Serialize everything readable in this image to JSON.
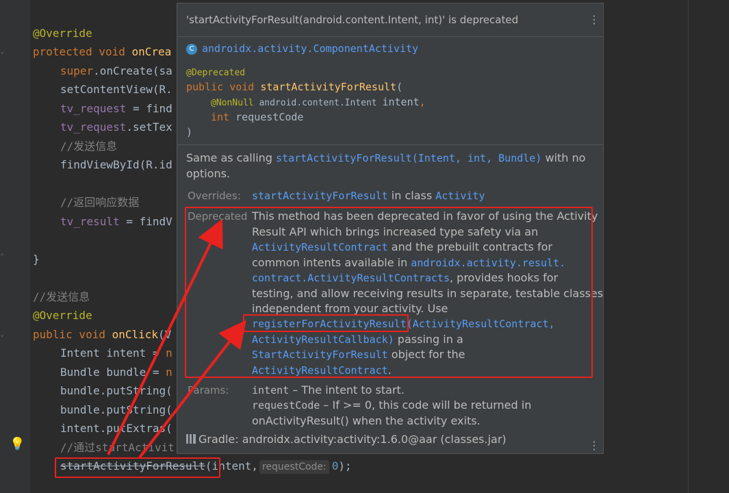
{
  "editor": {
    "top_partial": "",
    "lines": {
      "l1_ann": "@Override",
      "l2_kw": "protected void ",
      "l2_fn": "onCrea",
      "l3_kw": "super",
      "l3_rest": ".onCreate(sa",
      "l4": "setContentView(R.",
      "l5_field": "tv_request",
      "l5_rest": " = find",
      "l6_field": "tv_request",
      "l6_rest": ".setTex",
      "l7": "//发送信息",
      "l8": "findViewById(R.id",
      "l9": "//返回响应数据",
      "l10_field": "tv_result",
      "l10_rest": " = findV",
      "l11": "}",
      "l12": "//发送信息",
      "l13_ann": "@Override",
      "l14_kw": "public void ",
      "l14_fn": "onClick",
      "l14_rest": "(V",
      "l15_a": "Intent intent",
      "l15_b": " = ",
      "l15_kw": "n",
      "l16_a": "Bundle bundle",
      "l16_b": " = ",
      "l16_kw": "n",
      "l17": "bundle.putString(",
      "l18": "bundle.putString(",
      "l19": "intent.putExtras(",
      "l20": "//通过startActivit",
      "l21_strike": "startActivityForResult",
      "l21_a": "(intent,",
      "l21_hint": "requestCode:",
      "l21_num": "0",
      "l21_end": ");"
    }
  },
  "popup": {
    "title": "'startActivityForResult(android.content.Intent, int)' is deprecated",
    "class_badge": "C",
    "class_name": "androidx.activity.ComponentActivity",
    "sig_ann": "@Deprecated",
    "sig_kw": "public void ",
    "sig_fn": "startActivityForResult",
    "sig_open": "(",
    "param1_ann": "@NonNull",
    "param1_type": " android.content.Intent ",
    "param1_name": "intent",
    "param1_comma": ",",
    "param2_kw": "int",
    "param2_name": " requestCode",
    "sig_close": ")",
    "desc_a": "Same as calling ",
    "desc_link": "startActivityForResult(Intent, int, Bundle)",
    "desc_b": " with no",
    "desc_c": "options.",
    "overrides_label": "Overrides:",
    "overrides_link": "startActivityForResult",
    "overrides_mid": " in class ",
    "overrides_class": "Activity",
    "deprecated_label": "Deprecated",
    "dep_1": "This method has been deprecated in favor of using the Activity",
    "dep_2": "Result API which brings increased type safety via an",
    "dep_3_link": "ActivityResultContract",
    "dep_3_b": " and the prebuilt contracts for",
    "dep_4_a": "common intents available in ",
    "dep_4_link": "androidx.activity.result.",
    "dep_5_link": "contract.ActivityResultContracts",
    "dep_5_b": ", provides hooks for",
    "dep_6": "testing, and allow receiving results in separate, testable classes",
    "dep_7": "independent from your activity. Use",
    "dep_8_link": "registerForActivityResult(ActivityResultContract,",
    "dep_9_link": "ActivityResultCallback)",
    "dep_9_b": " passing in a",
    "dep_10_link": "StartActivityForResult",
    "dep_10_b": " object for the",
    "dep_11_link": "ActivityResultContract",
    "dep_11_b": ".",
    "params_label": "Params:",
    "param_1_name": "intent",
    "param_1_desc": " – The intent to start.",
    "param_2_name": "requestCode",
    "param_2_desc": " – If >= 0, this code will be returned in",
    "param_2_desc2": "onActivityResult() when the activity exits.",
    "gradle": "Gradle: androidx.activity:activity:1.6.0@aar (classes.jar)"
  },
  "icons": {
    "menu": "more-vertical-icon",
    "bulb": "lightbulb-icon",
    "class": "class-icon",
    "library": "library-icon"
  },
  "colors": {
    "annotation_red": "#e8221f",
    "link": "#589df6",
    "keyword": "#cc7832"
  }
}
